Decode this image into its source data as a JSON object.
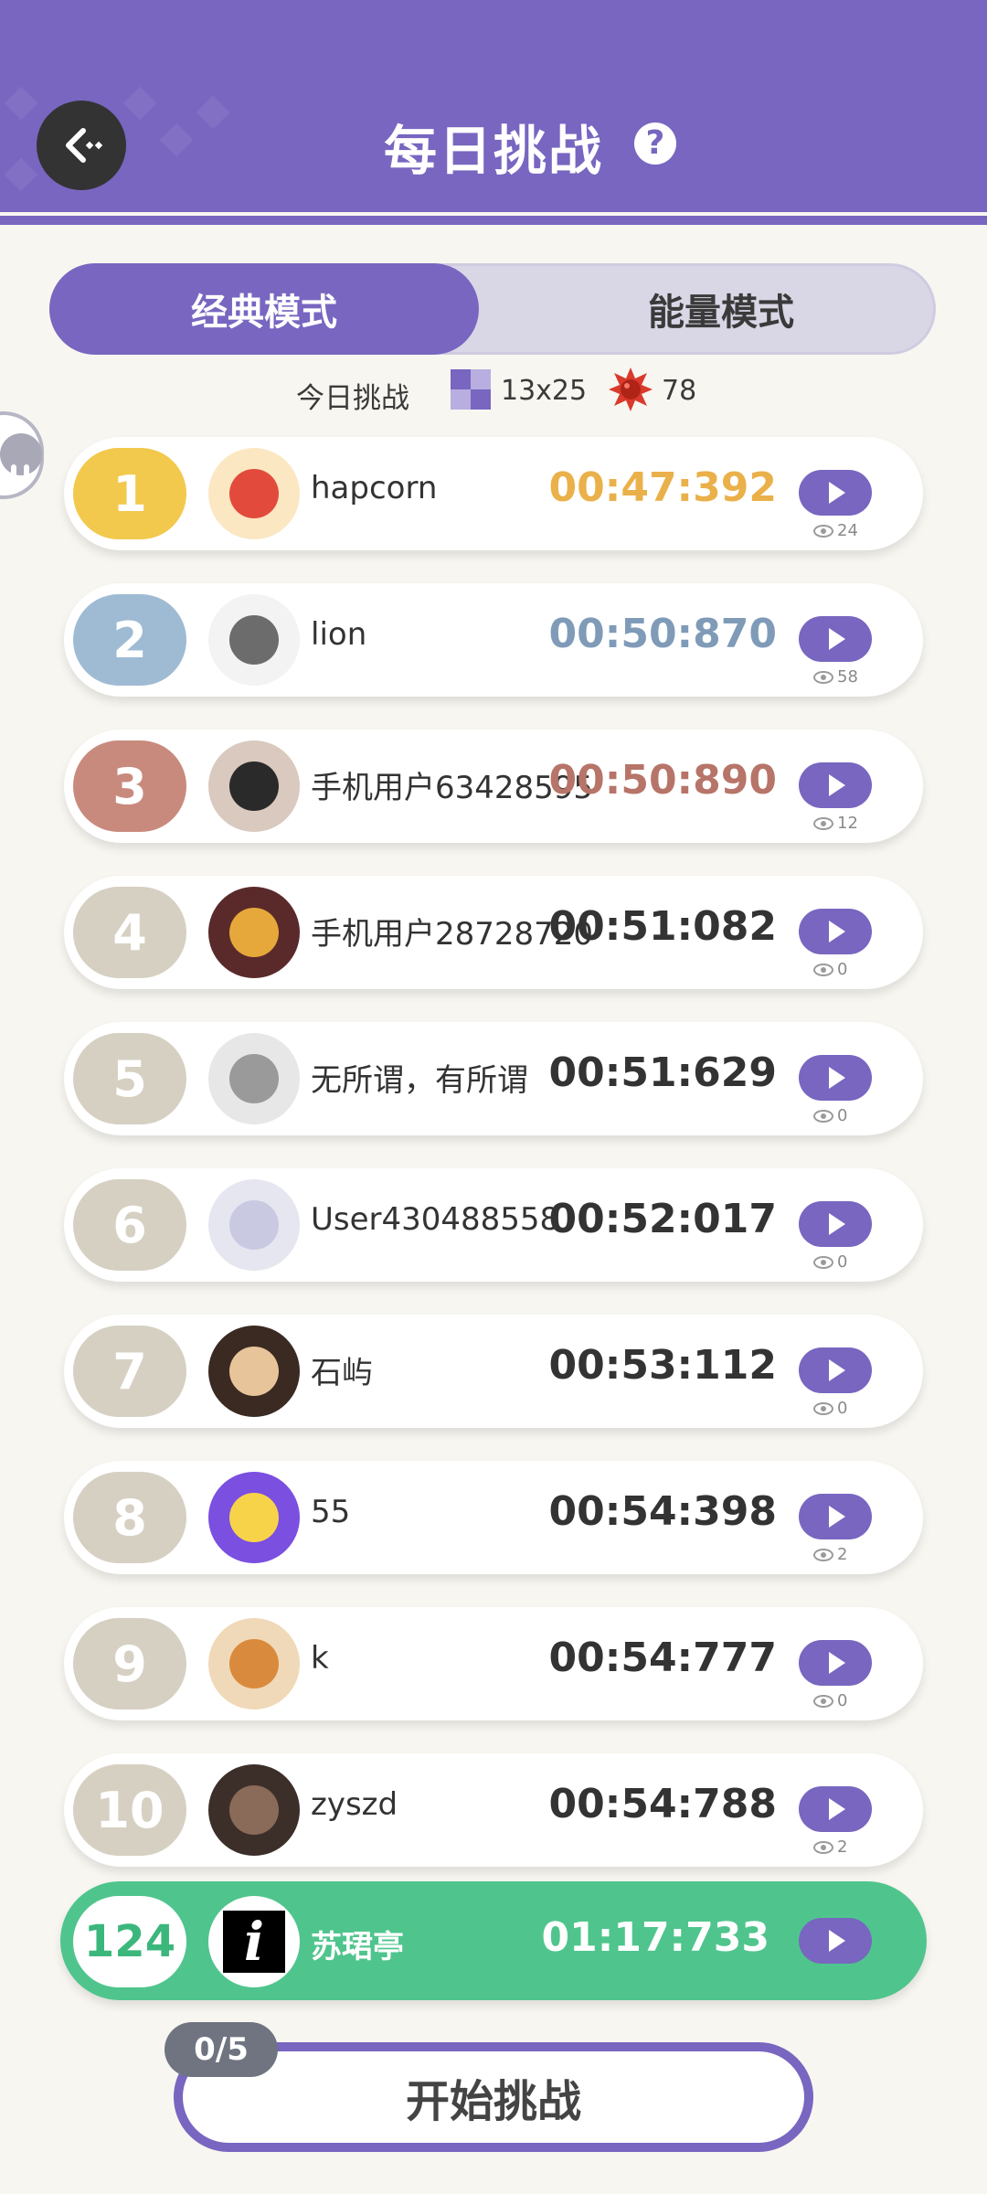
{
  "header": {
    "title": "每日挑战",
    "help_label": "?"
  },
  "tabs": [
    {
      "label": "经典模式",
      "active": true
    },
    {
      "label": "能量模式",
      "active": false
    }
  ],
  "challenge_info": {
    "label": "今日挑战",
    "board_size": "13x25",
    "mines": "78"
  },
  "colors": {
    "accent": "#7866c0",
    "me_row": "#4fc58d",
    "gold": "#f2c94c",
    "silver": "#9fbbd4",
    "bronze": "#c98a7e",
    "neutral_rank": "#d6d0c3"
  },
  "leaderboard": [
    {
      "rank": "1",
      "name": "hapcorn",
      "time": "00:47:392",
      "views": "24",
      "medal": "gold",
      "avatar": "popcorn-avatar"
    },
    {
      "rank": "2",
      "name": "lion",
      "time": "00:50:870",
      "views": "58",
      "medal": "silver",
      "avatar": "bear-avatar"
    },
    {
      "rank": "3",
      "name": "手机用户63428595",
      "time": "00:50:890",
      "views": "12",
      "medal": "bronze",
      "avatar": "boy-avatar"
    },
    {
      "rank": "4",
      "name": "手机用户28728720",
      "time": "00:51:082",
      "views": "0",
      "medal": "none",
      "avatar": "girl-avatar"
    },
    {
      "rank": "5",
      "name": "无所谓，有所谓",
      "time": "00:51:629",
      "views": "0",
      "medal": "none",
      "avatar": "photo-avatar"
    },
    {
      "rank": "6",
      "name": "User430488558",
      "time": "00:52:017",
      "views": "0",
      "medal": "none",
      "avatar": "anime-avatar"
    },
    {
      "rank": "7",
      "name": "石屿",
      "time": "00:53:112",
      "views": "0",
      "medal": "none",
      "avatar": "cat-avatar"
    },
    {
      "rank": "8",
      "name": "55",
      "time": "00:54:398",
      "views": "2",
      "medal": "none",
      "avatar": "cartoon-avatar"
    },
    {
      "rank": "9",
      "name": "k",
      "time": "00:54:777",
      "views": "0",
      "medal": "none",
      "avatar": "dog-avatar"
    },
    {
      "rank": "10",
      "name": "zyszd",
      "time": "00:54:788",
      "views": "2",
      "medal": "none",
      "avatar": "doll-avatar"
    }
  ],
  "me": {
    "rank": "124",
    "name": "苏珺亭",
    "time": "01:17:733",
    "avatar_letter": "i"
  },
  "start": {
    "label": "开始挑战",
    "attempts": "0/5"
  }
}
